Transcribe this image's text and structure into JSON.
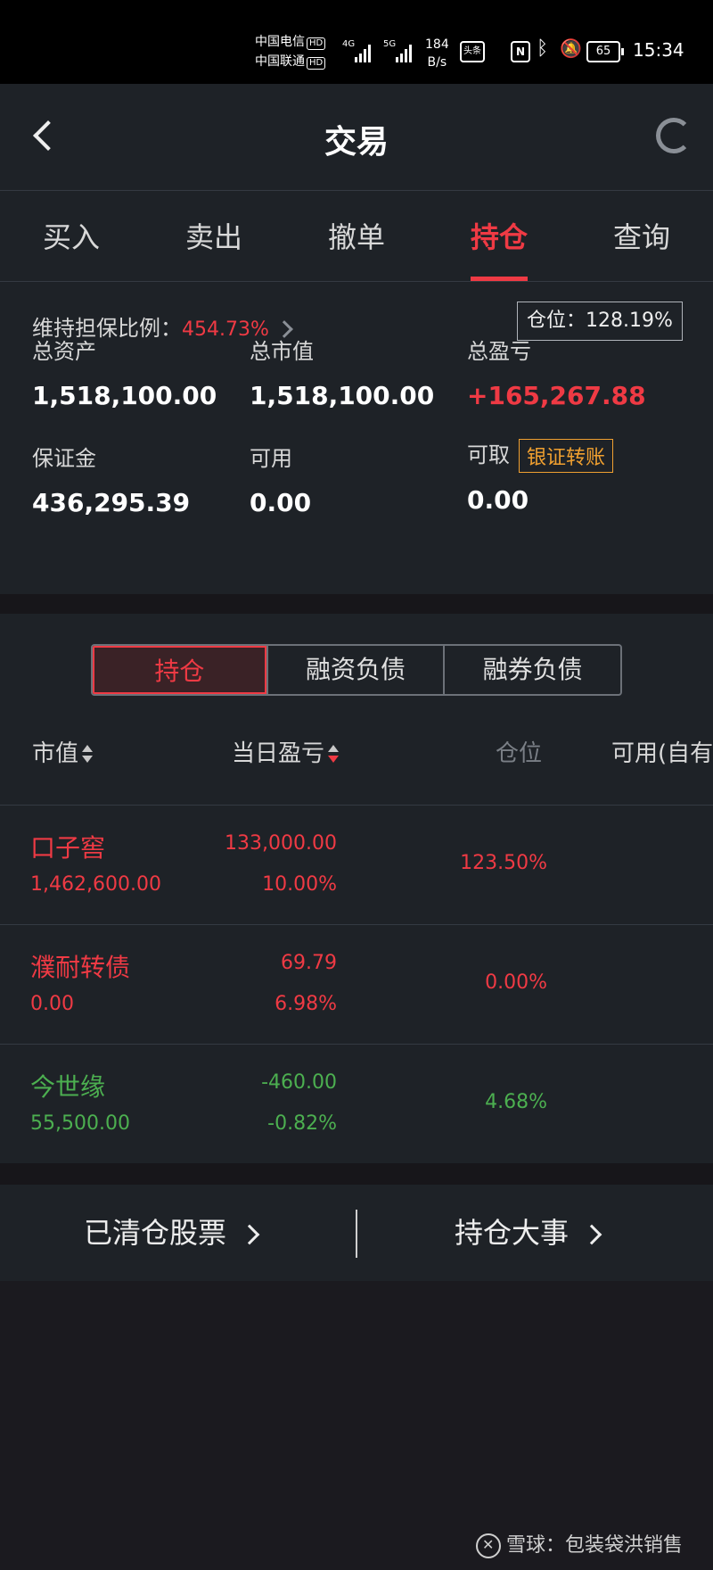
{
  "status_bar": {
    "carrier1": "中国电信",
    "carrier2": "中国联通",
    "hd": "HD",
    "net1": "4G",
    "net2": "5G",
    "speed_value": "184",
    "speed_unit": "B/s",
    "app_badge": "头条",
    "nfc": "N",
    "battery": "65",
    "time": "15:34"
  },
  "nav": {
    "title": "交易",
    "back_icon": "chevron-left-icon",
    "refresh_icon": "refresh-icon"
  },
  "tabs": [
    {
      "label": "买入"
    },
    {
      "label": "卖出"
    },
    {
      "label": "撤单"
    },
    {
      "label": "持仓",
      "active": true
    },
    {
      "label": "查询"
    }
  ],
  "summary": {
    "margin_ratio_label": "维持担保比例：",
    "margin_ratio_value": "454.73%",
    "position_label": "仓位：128.19%",
    "total_assets_label": "总资产",
    "total_assets": "1,518,100.00",
    "market_value_label": "总市值",
    "market_value": "1,518,100.00",
    "total_pnl_label": "总盈亏",
    "total_pnl": "+165,267.88",
    "deposit_label": "保证金",
    "deposit": "436,295.39",
    "available_label": "可用",
    "available": "0.00",
    "withdrawable_label": "可取",
    "withdrawable": "0.00",
    "transfer_button": "银证转账"
  },
  "segments": [
    {
      "label": "持仓",
      "active": true
    },
    {
      "label": "融资负债"
    },
    {
      "label": "融券负债"
    }
  ],
  "columns": {
    "market_value": "市值",
    "daily_pnl": "当日盈亏",
    "position": "仓位",
    "available": "可用(自有"
  },
  "holdings": [
    {
      "name": "口子窖",
      "market_value": "1,462,600.00",
      "pnl": "133,000.00",
      "pnl_pct": "10.00%",
      "position": "123.50%",
      "color": "#ef3a44"
    },
    {
      "name": "濮耐转债",
      "market_value": "0.00",
      "pnl": "69.79",
      "pnl_pct": "6.98%",
      "position": "0.00%",
      "color": "#ef3a44"
    },
    {
      "name": "今世缘",
      "market_value": "55,500.00",
      "pnl": "-460.00",
      "pnl_pct": "-0.82%",
      "position": "4.68%",
      "color": "#4caf50"
    }
  ],
  "footer": {
    "cleared_stocks": "已清仓股票",
    "position_events": "持仓大事"
  },
  "watermark": "雪球：包装袋洪销售",
  "colors": {
    "up": "#ef3a44",
    "down": "#4caf50",
    "accent_orange": "#f0a030",
    "panel": "#1e2227"
  }
}
